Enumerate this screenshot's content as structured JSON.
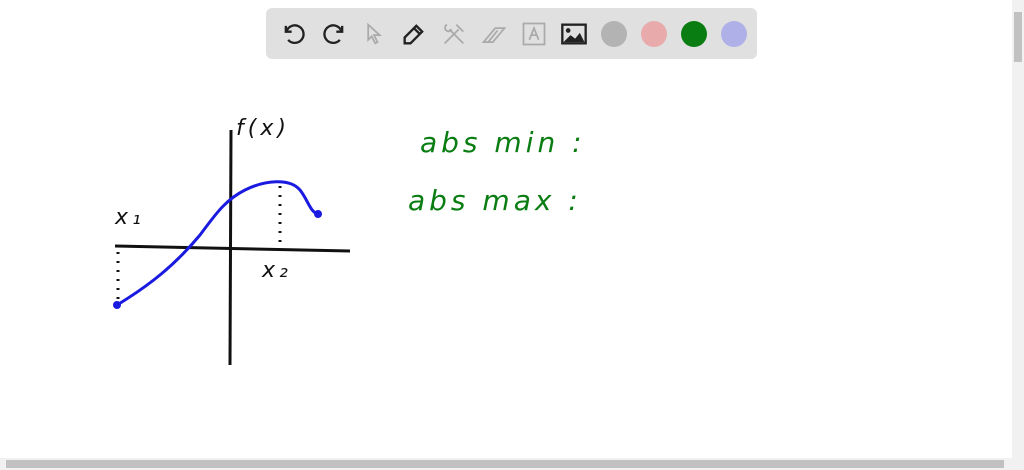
{
  "toolbar": {
    "tools": [
      "undo-icon",
      "redo-icon",
      "select-icon",
      "pen-icon",
      "tools-icon",
      "eraser-icon",
      "text-icon",
      "image-icon"
    ],
    "colors": [
      "#b3b3b3",
      "#e8aaaa",
      "#0a7d12",
      "#b0b0e8"
    ]
  },
  "drawing": {
    "y_axis_label": "f(x)",
    "x1_label": "x₁",
    "x2_label": "x₂",
    "abs_min_label": "abs min :",
    "abs_max_label": "abs max :",
    "curve_color": "#1a1ae0",
    "text_color": "#0a7d12"
  }
}
